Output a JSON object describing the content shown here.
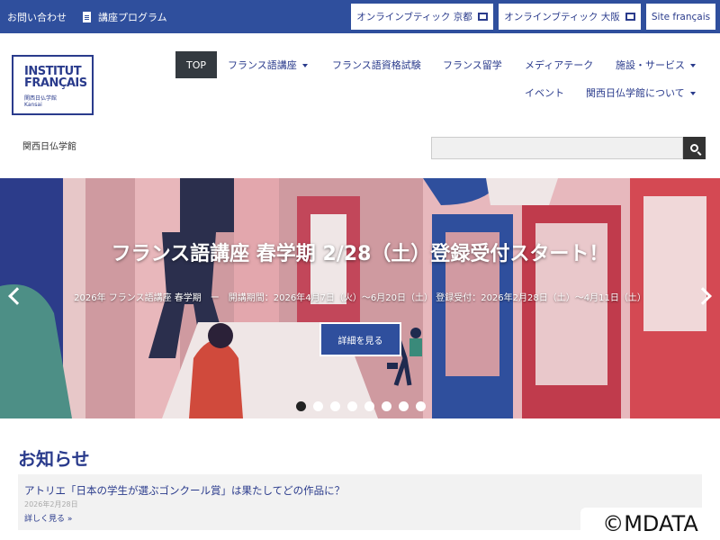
{
  "topbar": {
    "contact": "お問い合わせ",
    "program": "講座プログラム",
    "boutique_kyoto": "オンラインブティック 京都",
    "boutique_osaka": "オンラインブティック 大阪",
    "site_fr": "Site français"
  },
  "logo": {
    "line1": "INSTITUT",
    "line2": "FRANÇAIS",
    "line3": "関西日仏学館",
    "line4": "Kansai"
  },
  "nav": {
    "top": "TOP",
    "courses": "フランス語講座",
    "exams": "フランス語資格試験",
    "study": "フランス留学",
    "mediatheque": "メディアテーク",
    "facilities": "施設・サービス",
    "events": "イベント",
    "about": "関西日仏学館について"
  },
  "site_label": "関西日仏学館",
  "search": {
    "value": ""
  },
  "hero": {
    "title": "フランス語講座 春学期 2/28（土）登録受付スタート！",
    "subtitle": "2026年 フランス語講座 春学期　ー　開講期間：2026年4月7日（火）～6月20日（土）  登録受付：2026年2月28日（土）～4月11日（土）",
    "button": "詳細を見る",
    "slide_count": 8,
    "active_slide": 1
  },
  "news": {
    "heading": "お知らせ",
    "items": [
      {
        "headline": "アトリエ「日本の学生が選ぶゴンクール賞」は果たしてどの作品に？",
        "date": "2026年2月28日",
        "more": "詳しく見る »"
      }
    ]
  },
  "watermark": "©MDATA",
  "colors": {
    "primary": "#2f4f9d",
    "text": "#2a3b8c",
    "top_active": "#343a40"
  }
}
